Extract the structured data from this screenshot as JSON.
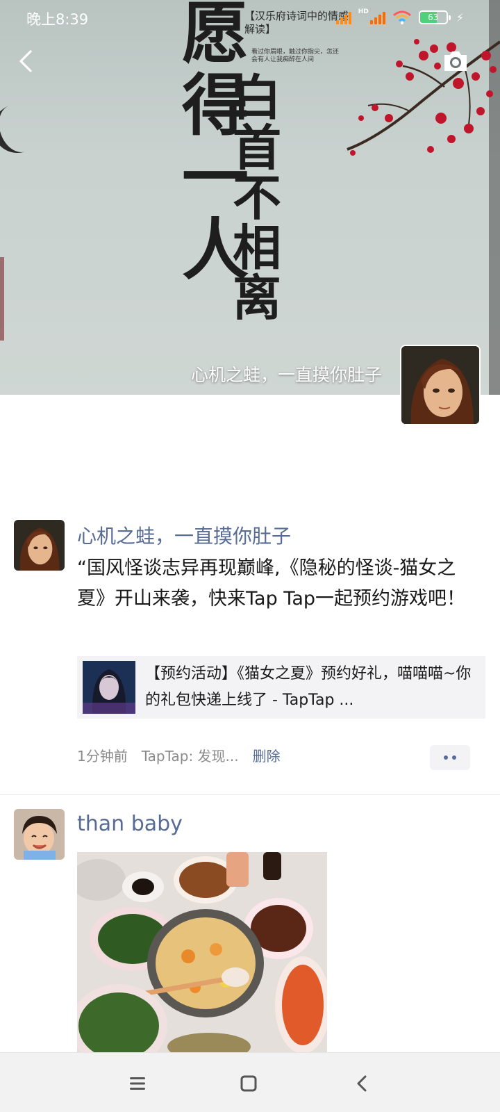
{
  "status_bar": {
    "time": "晚上8:39",
    "network_badge": "HD",
    "battery": "63",
    "battery_level_percent": 63
  },
  "cover": {
    "calligraphy_main": "愿得一人",
    "calligraphy_side": "白首不相离",
    "subtitle": "【汉乐府诗词中的情感解读】",
    "tagline": "看过你眉眼，触过你指尖，怎还会有人让我痴醉在人间",
    "owner_name": "心机之蛙，一直摸你肚子"
  },
  "posts": [
    {
      "nickname": "心机之蛙，一直摸你肚子",
      "text": "“国风怪谈志异再现巅峰,《隐秘的怪谈-猫女之夏》开山来袭，快来Tap Tap一起预约游戏吧！",
      "share_title": "【预约活动】《猫女之夏》预约好礼，喵喵喵~你的礼包快递上线了 - TapTap ...",
      "time": "1分钟前",
      "source": "TapTap: 发现...",
      "delete_label": "删除"
    },
    {
      "nickname": "than baby"
    }
  ],
  "icons": {
    "back": "chevron-left-icon",
    "camera": "camera-icon",
    "more": "more-dots-icon",
    "nav_menu": "menu-icon",
    "nav_home": "home-square-icon",
    "nav_back": "back-triangle-icon"
  },
  "colors": {
    "link": "#576b95",
    "meta": "#8a8a8a",
    "card_bg": "#f3f3f5",
    "blossom": "#c0162c"
  }
}
